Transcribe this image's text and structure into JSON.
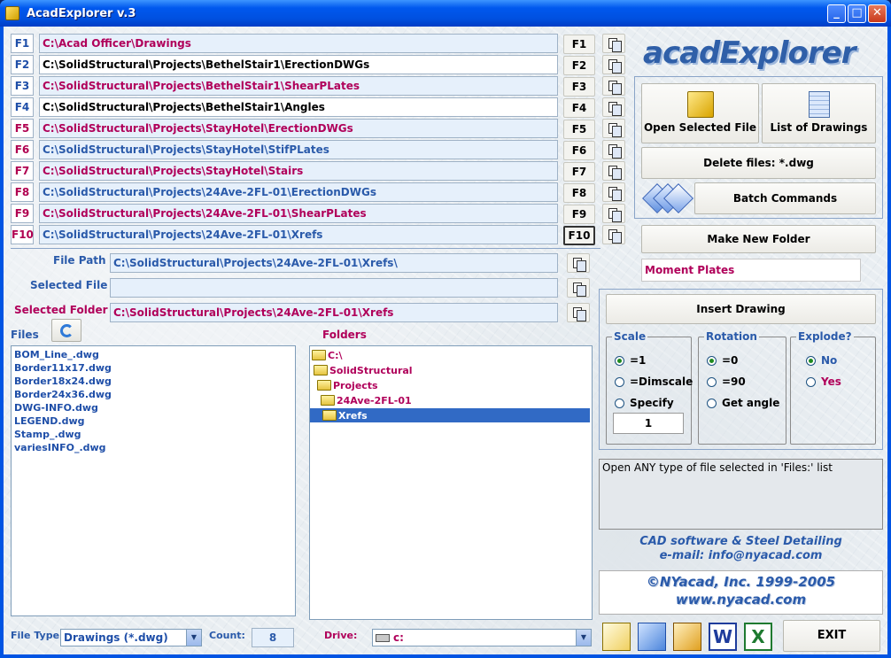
{
  "window": {
    "title": "AcadExplorer v.3"
  },
  "logo": {
    "text": "acadExplorer"
  },
  "favorites": [
    {
      "key": "F1",
      "path": "C:\\Acad Officer\\Drawings",
      "button": "F1",
      "style": "red",
      "keystyle": "blue"
    },
    {
      "key": "F2",
      "path": "C:\\SolidStructural\\Projects\\BethelStair1\\ErectionDWGs",
      "button": "F2",
      "style": "blk",
      "keystyle": "blue"
    },
    {
      "key": "F3",
      "path": "C:\\SolidStructural\\Projects\\BethelStair1\\ShearPLates",
      "button": "F3",
      "style": "red",
      "keystyle": "blue"
    },
    {
      "key": "F4",
      "path": "C:\\SolidStructural\\Projects\\BethelStair1\\Angles",
      "button": "F4",
      "style": "blk",
      "keystyle": "blue"
    },
    {
      "key": "F5",
      "path": "C:\\SolidStructural\\Projects\\StayHotel\\ErectionDWGs",
      "button": "F5",
      "style": "red",
      "keystyle": "red"
    },
    {
      "key": "F6",
      "path": "C:\\SolidStructural\\Projects\\StayHotel\\StifPLates",
      "button": "F6",
      "style": "blue",
      "keystyle": "red"
    },
    {
      "key": "F7",
      "path": "C:\\SolidStructural\\Projects\\StayHotel\\Stairs",
      "button": "F7",
      "style": "red",
      "keystyle": "red"
    },
    {
      "key": "F8",
      "path": "C:\\SolidStructural\\Projects\\24Ave-2FL-01\\ErectionDWGs",
      "button": "F8",
      "style": "blue",
      "keystyle": "red"
    },
    {
      "key": "F9",
      "path": "C:\\SolidStructural\\Projects\\24Ave-2FL-01\\ShearPLates",
      "button": "F9",
      "style": "red",
      "keystyle": "red"
    },
    {
      "key": "F10",
      "path": "C:\\SolidStructural\\Projects\\24Ave-2FL-01\\Xrefs",
      "button": "F10",
      "style": "blue",
      "keystyle": "red"
    }
  ],
  "fields": {
    "file_path_label": "File Path",
    "file_path": "C:\\SolidStructural\\Projects\\24Ave-2FL-01\\Xrefs\\",
    "selected_file_label": "Selected File",
    "selected_file": "",
    "selected_folder_label": "Selected Folder",
    "selected_folder": "C:\\SolidStructural\\Projects\\24Ave-2FL-01\\Xrefs"
  },
  "files": {
    "label": "Files",
    "items": [
      "BOM_Line_.dwg",
      "Border11x17.dwg",
      "Border18x24.dwg",
      "Border24x36.dwg",
      "DWG-INFO.dwg",
      "LEGEND.dwg",
      "Stamp_.dwg",
      "variesINFO_.dwg"
    ]
  },
  "folders": {
    "label": "Folders",
    "items": [
      "C:\\",
      "SolidStructural",
      "Projects",
      "24Ave-2FL-01",
      "Xrefs"
    ]
  },
  "actions": {
    "open_selected": "Open Selected File",
    "list_drawings": "List of Drawings",
    "delete_files": "Delete files: *.dwg",
    "batch_commands": "Batch Commands",
    "make_new_folder": "Make New Folder",
    "new_folder_name": "Moment Plates",
    "insert_drawing": "Insert Drawing"
  },
  "scale": {
    "label": "Scale",
    "opt1": "=1",
    "opt2": "=Dimscale",
    "opt3": "Specify",
    "value": "1"
  },
  "rotation": {
    "label": "Rotation",
    "opt1": "=0",
    "opt2": "=90",
    "opt3": "Get angle"
  },
  "explode": {
    "label": "Explode?",
    "opt1": "No",
    "opt2": "Yes"
  },
  "info_text": "Open ANY type of file selected in 'Files:' list",
  "credits": {
    "line1": "CAD software & Steel Detailing",
    "line2": "e-mail: info@nyacad.com",
    "line3": "©NYacad, Inc. 1999-2005",
    "line4": "www.nyacad.com"
  },
  "bottom": {
    "file_type_label": "File Type:",
    "file_type": "Drawings (*.dwg)",
    "count_label": "Count:",
    "count": "8",
    "drive_label": "Drive:",
    "drive": "c:",
    "exit": "EXIT"
  }
}
